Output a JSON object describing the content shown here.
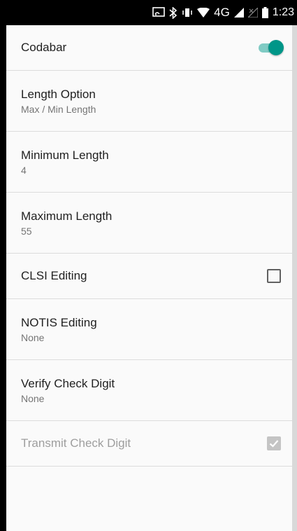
{
  "status_bar": {
    "time": "1:23",
    "network": "4G",
    "icons": [
      "cast-icon",
      "bluetooth-icon",
      "vibrate-icon",
      "wifi-icon",
      "signal-icon",
      "no-signal-icon",
      "battery-icon"
    ]
  },
  "settings": {
    "codabar": {
      "title": "Codabar",
      "enabled": true
    },
    "length_option": {
      "title": "Length Option",
      "summary": "Max / Min Length"
    },
    "minimum_length": {
      "title": "Minimum Length",
      "summary": "4"
    },
    "maximum_length": {
      "title": "Maximum Length",
      "summary": "55"
    },
    "clsi_editing": {
      "title": "CLSI Editing",
      "checked": false
    },
    "notis_editing": {
      "title": "NOTIS Editing",
      "summary": "None"
    },
    "verify_check_digit": {
      "title": "Verify Check Digit",
      "summary": "None"
    },
    "transmit_check_digit": {
      "title": "Transmit Check Digit",
      "checked": true,
      "enabled": false
    }
  },
  "colors": {
    "accent": "#009688",
    "accent_track": "#80cbc4",
    "divider": "#dcdcdc"
  }
}
